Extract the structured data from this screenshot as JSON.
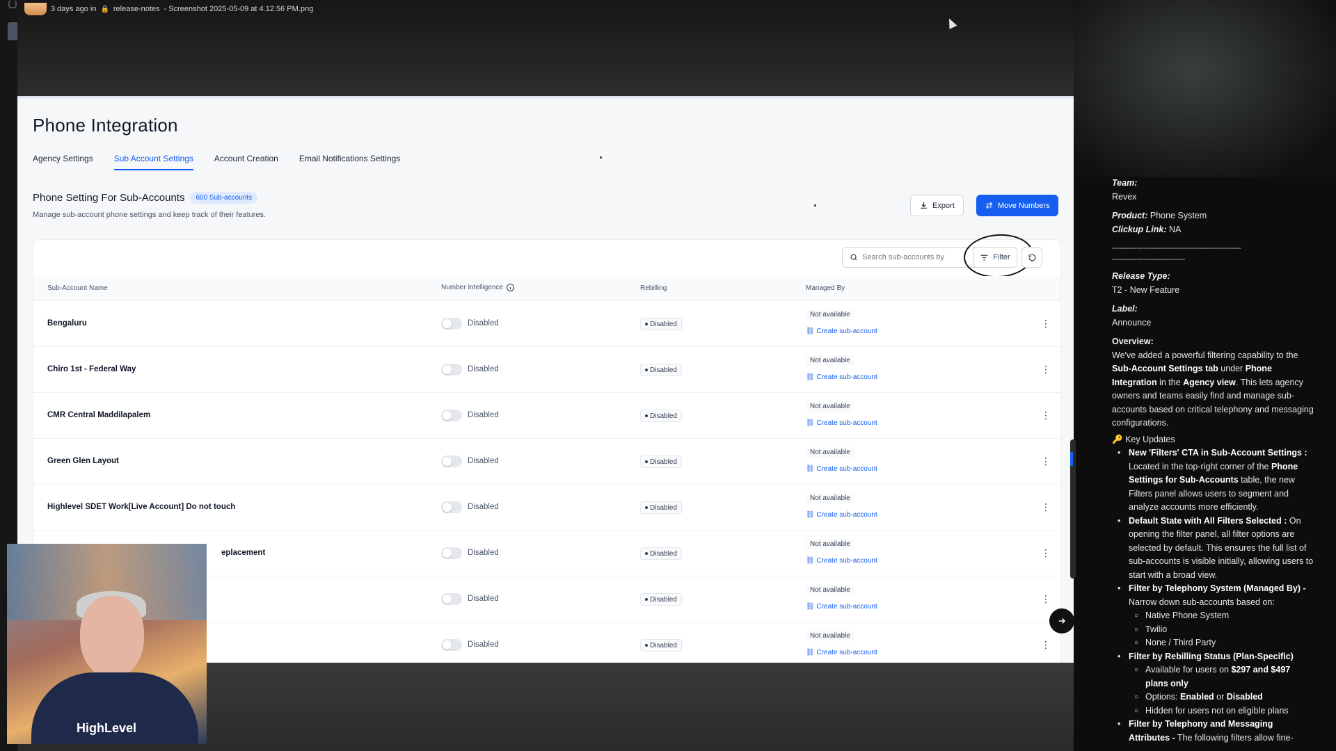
{
  "top_meta": {
    "posted": "3 days ago in",
    "channel": "release-notes",
    "file": "- Screenshot 2025-05-09 at 4.12.56 PM.png"
  },
  "page": {
    "title": "Phone Integration",
    "tabs": [
      "Agency Settings",
      "Sub Account Settings",
      "Account Creation",
      "Email Notifications Settings"
    ],
    "active_tab": "Sub Account Settings"
  },
  "section": {
    "title": "Phone Setting For Sub-Accounts",
    "count_badge": "600 Sub-accounts",
    "subtitle": "Manage sub-account phone settings and keep track of their features."
  },
  "actions": {
    "export": "Export",
    "move_numbers": "Move Numbers",
    "search_placeholder": "Search sub-accounts by",
    "filter": "Filter"
  },
  "table": {
    "headers": [
      "Sub-Account Name",
      "Number Intelligence",
      "Rebilling",
      "Managed By"
    ],
    "rows": [
      {
        "name": "Bengaluru",
        "ni": "Disabled",
        "rebilling": "Disabled",
        "managed": "Not available",
        "link": "Create sub-account"
      },
      {
        "name": "Chiro 1st - Federal Way",
        "ni": "Disabled",
        "rebilling": "Disabled",
        "managed": "Not available",
        "link": "Create sub-account"
      },
      {
        "name": "CMR Central Maddilapalem",
        "ni": "Disabled",
        "rebilling": "Disabled",
        "managed": "Not available",
        "link": "Create sub-account"
      },
      {
        "name": "Green Glen Layout",
        "ni": "Disabled",
        "rebilling": "Disabled",
        "managed": "Not available",
        "link": "Create sub-account"
      },
      {
        "name": "Highlevel SDET Work[Live Account] Do not touch",
        "ni": "Disabled",
        "rebilling": "Disabled",
        "managed": "Not available",
        "link": "Create sub-account"
      },
      {
        "name": "eplacement",
        "ni": "Disabled",
        "rebilling": "Disabled",
        "managed": "Not available",
        "link": "Create sub-account"
      },
      {
        "name": "",
        "ni": "Disabled",
        "rebilling": "Disabled",
        "managed": "Not available",
        "link": "Create sub-account"
      },
      {
        "name": "",
        "ni": "Disabled",
        "rebilling": "Disabled",
        "managed": "Not available",
        "link": "Create sub-account"
      }
    ]
  },
  "webcam": {
    "shirt_text": "HighLevel"
  },
  "notes": {
    "team_label": "Team:",
    "team": "Revex",
    "product_label": "Product:",
    "product": "Phone System",
    "clickup_label": "Clickup Link:",
    "clickup": "NA",
    "divider1": "-----------------------------------------------------",
    "divider2": "------------------------------",
    "release_type_label": "Release Type:",
    "release_type": "T2 - New Feature",
    "label_label": "Label:",
    "label": "Announce",
    "overview_label": "Overview:",
    "overview": {
      "p1": "We've added a powerful filtering capability to the ",
      "b1": "Sub-Account Settings tab",
      "p2": " under ",
      "b2": "Phone Integration",
      "p3": " in the ",
      "b3": "Agency view",
      "p4": ". This lets agency owners and teams easily find and manage sub-accounts based on critical telephony and messaging configurations."
    },
    "key_updates_icon": "🔑",
    "key_updates_title": "Key Updates",
    "items": {
      "i1_b": "New 'Filters' CTA in Sub-Account Settings :",
      "i1_t1": " Located in the top-right corner of the ",
      "i1_b2": "Phone Settings for Sub-Accounts",
      "i1_t2": " table, the new Filters panel allows users to segment and analyze accounts more efficiently.",
      "i2_b": "Default State with All Filters Selected :",
      "i2_t": " On opening the filter panel, all filter options are selected by default. This ensures the full list of sub-accounts is visible initially, allowing users to start with a broad view.",
      "i3_b": "Filter by Telephony System (Managed By) -",
      "i3_t": " Narrow down sub-accounts based on:",
      "i3_subs": [
        "Native Phone System",
        "Twilio",
        "None / Third Party"
      ],
      "i4_b": "Filter by Rebilling Status (Plan-Specific)",
      "i4_s1_t": "Available for users on ",
      "i4_s1_b": "$297 and $497 plans only",
      "i4_s2_t": "Options: ",
      "i4_s2_b1": "Enabled",
      "i4_s2_or": " or ",
      "i4_s2_b2": "Disabled",
      "i4_s3": "Hidden for users not on eligible plans",
      "i5_b": "Filter by Telephony and Messaging Attributes -",
      "i5_t": " The following filters allow fine-"
    }
  }
}
